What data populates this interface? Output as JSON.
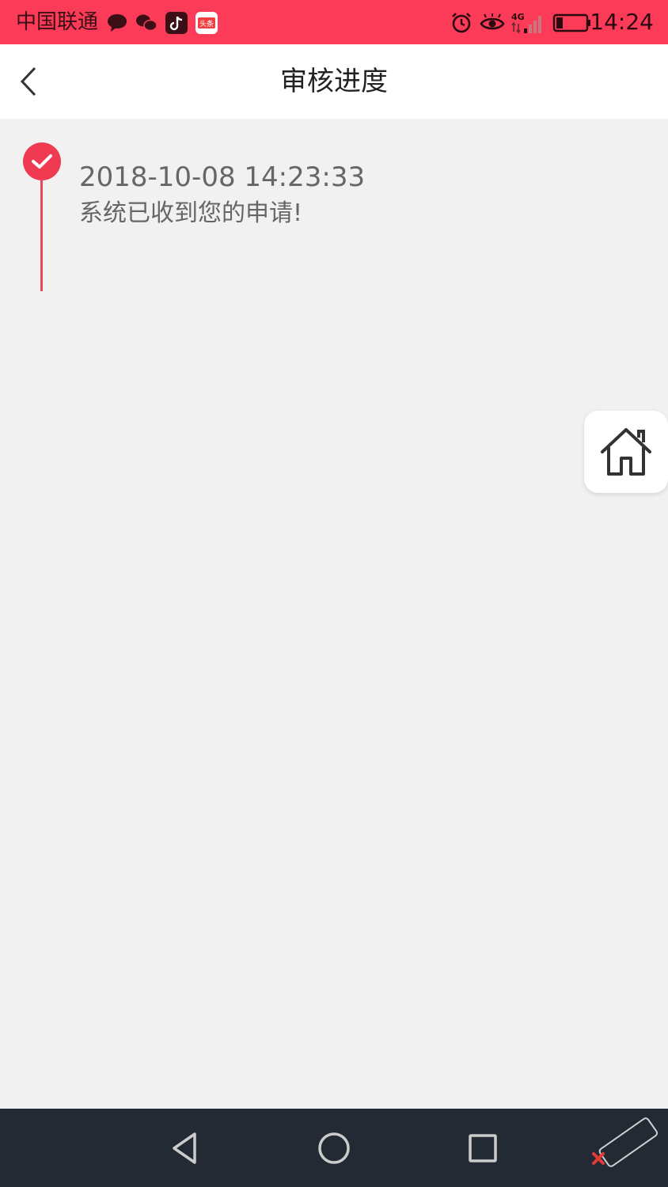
{
  "status_bar": {
    "carrier": "中国联通",
    "time": "14:24",
    "network": "4G",
    "app_badge": "头条",
    "icons": [
      "message-icon",
      "wechat-icon",
      "tiktok-icon",
      "toutiao-icon",
      "alarm-icon",
      "eye-icon",
      "signal-icon",
      "battery-icon"
    ]
  },
  "nav": {
    "title": "审核进度",
    "back_icon": "back-chevron-icon"
  },
  "timeline": [
    {
      "time": "2018-10-08 14:23:33",
      "message": "系统已收到您的申请!",
      "status": "done"
    }
  ],
  "floating": {
    "icon": "home-icon"
  },
  "system_nav": {
    "icons": [
      "back-triangle-icon",
      "home-circle-icon",
      "recents-square-icon"
    ]
  },
  "colors": {
    "accent": "#fb3b57",
    "timeline_dot": "#ef3a52",
    "background": "#f1f1f1",
    "text_secondary": "#666666",
    "system_nav_bg": "#232a34"
  }
}
